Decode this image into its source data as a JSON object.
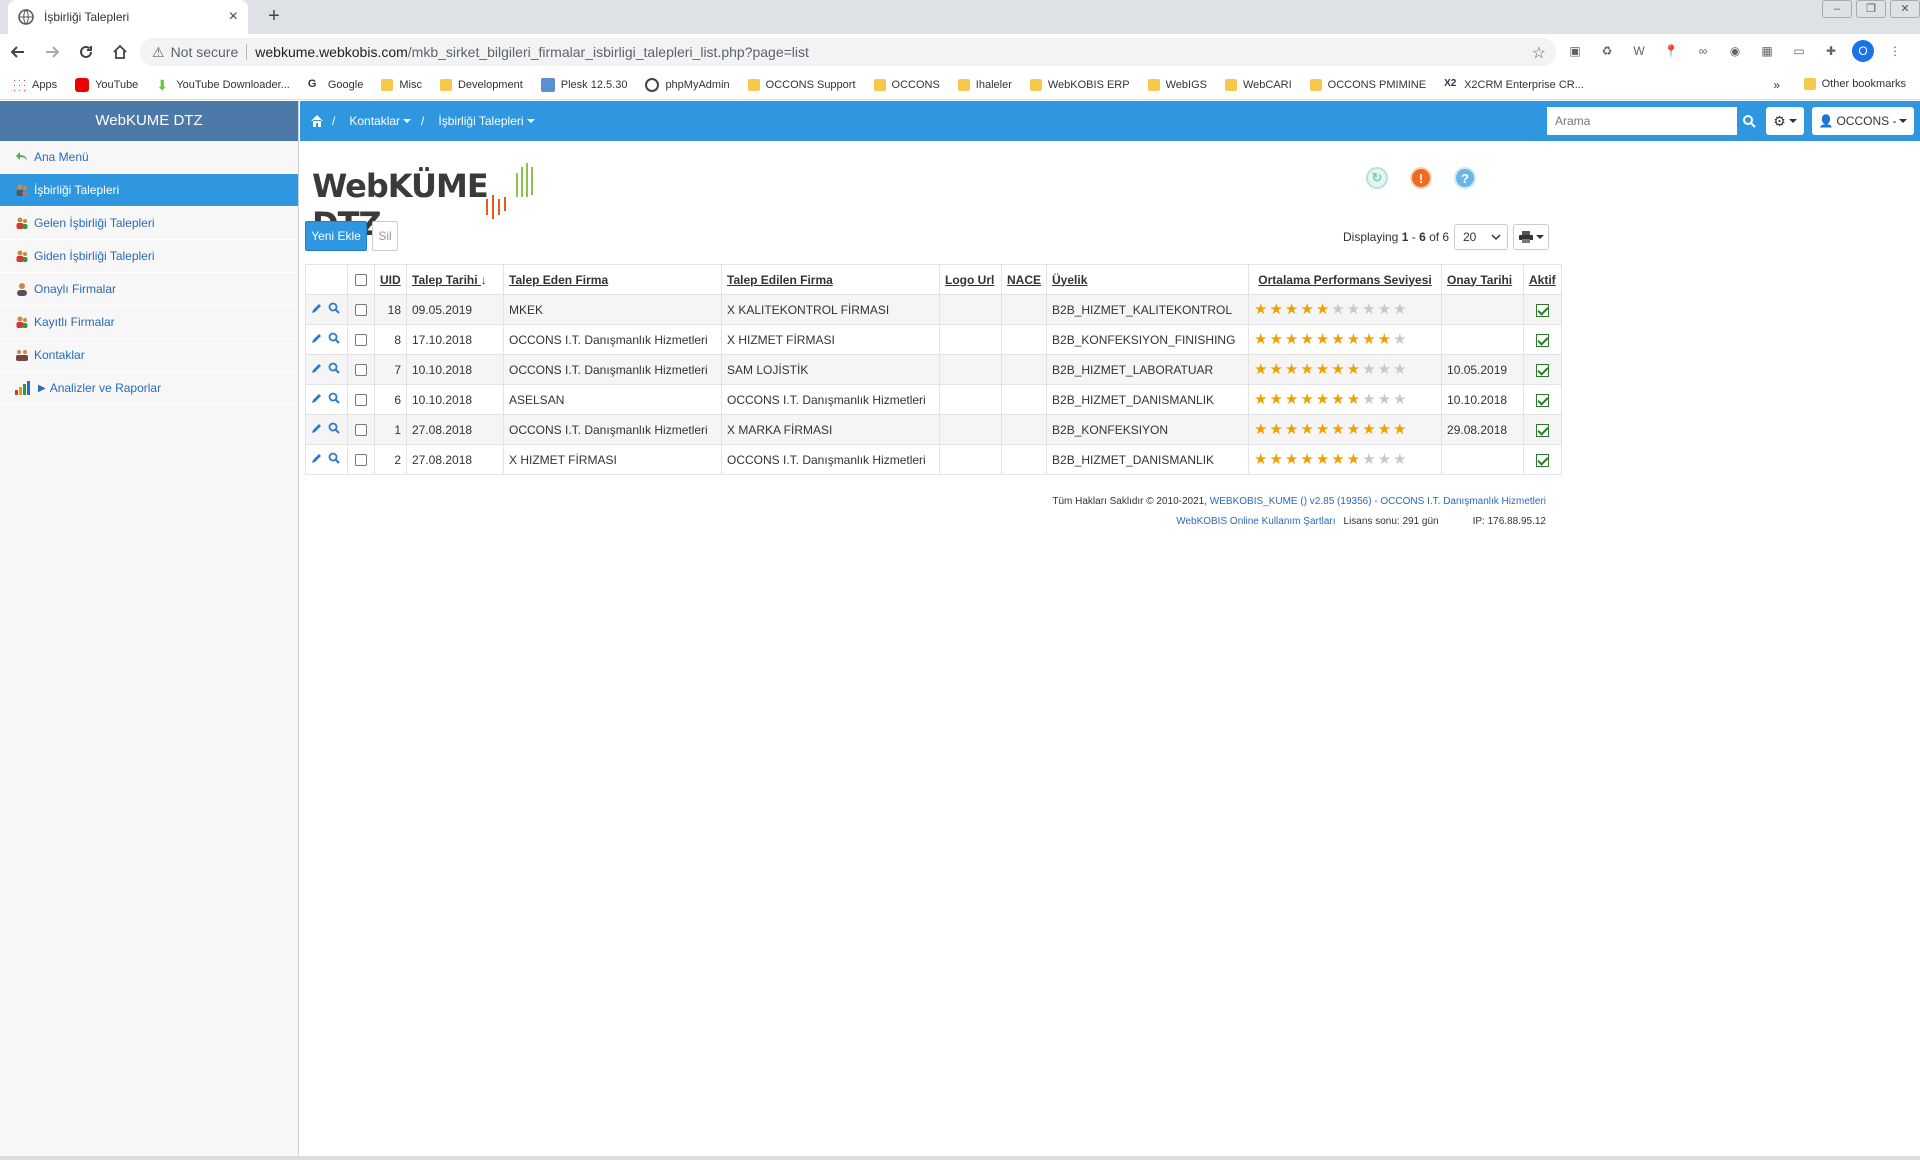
{
  "browser": {
    "tab_title": "İşbirliği Talepleri",
    "security_label": "Not secure",
    "url_host": "webkume.webkobis.com",
    "url_path": "/mkb_sirket_bilgileri_firmalar_isbirligi_talepleri_list.php?page=list",
    "bookmarks": [
      "Apps",
      "YouTube",
      "YouTube Downloader...",
      "Google",
      "Misc",
      "Development",
      "Plesk 12.5.30",
      "phpMyAdmin",
      "OCCONS Support",
      "OCCONS",
      "Ihaleler",
      "WebKOBIS ERP",
      "WebIGS",
      "WebCARI",
      "OCCONS PMIMINE",
      "X2CRM Enterprise CR..."
    ],
    "bookmarks_more": "»",
    "other_bookmarks": "Other bookmarks",
    "profile_initial": "O"
  },
  "sidebar": {
    "title": "WebKUME DTZ",
    "items": [
      {
        "label": "Ana Menü",
        "icon": "back-arrow-icon"
      },
      {
        "label": "İşbirliği Talepleri",
        "icon": "users-icon",
        "active": true
      },
      {
        "label": "Gelen İşbirliği Talepleri",
        "icon": "users-icon"
      },
      {
        "label": "Giden İşbirliği Talepleri",
        "icon": "users-icon"
      },
      {
        "label": "Onaylı Firmalar",
        "icon": "user-icon"
      },
      {
        "label": "Kayıtlı Firmalar",
        "icon": "users-icon"
      },
      {
        "label": "Kontaklar",
        "icon": "contacts-icon"
      },
      {
        "label": "Analizler ve Raporlar",
        "icon": "bar-chart-icon"
      }
    ]
  },
  "topnav": {
    "crumb1": "Kontaklar",
    "crumb2": "İşbirliği Talepleri",
    "search_placeholder": "Arama",
    "user_label": "OCCONS -"
  },
  "main": {
    "logo_text": "WebKÜME DTZ",
    "new_button": "Yeni Ekle",
    "delete_button": "Sil",
    "paging_prefix": "Displaying ",
    "paging_from": "1",
    "paging_dash": " - ",
    "paging_to": "6",
    "paging_of": " of 6",
    "page_size": "20"
  },
  "table": {
    "columns": [
      "UID",
      "Talep Tarihi",
      "Talep Eden Firma",
      "Talep Edilen Firma",
      "Logo Url",
      "NACE",
      "Üyelik",
      "Ortalama Performans Seviyesi",
      "Onay Tarihi",
      "Aktif"
    ],
    "rows": [
      {
        "uid": "18",
        "date": "09.05.2019",
        "from": "MKEK",
        "to": "X KALITEKONTROL FİRMASI",
        "logo": "",
        "nace": "",
        "membership": "B2B_HIZMET_KALITEKONTROL",
        "rating": 5,
        "approval": "",
        "active": true
      },
      {
        "uid": "8",
        "date": "17.10.2018",
        "from": "OCCONS I.T. Danışmanlık Hizmetleri",
        "to": "X HIZMET FİRMASI",
        "logo": "",
        "nace": "",
        "membership": "B2B_KONFEKSIYON_FINISHING",
        "rating": 9,
        "approval": "",
        "active": true
      },
      {
        "uid": "7",
        "date": "10.10.2018",
        "from": "OCCONS I.T. Danışmanlık Hizmetleri",
        "to": "SAM LOJİSTİK",
        "logo": "",
        "nace": "",
        "membership": "B2B_HIZMET_LABORATUAR",
        "rating": 7,
        "approval": "10.05.2019",
        "active": true
      },
      {
        "uid": "6",
        "date": "10.10.2018",
        "from": "ASELSAN",
        "to": "OCCONS I.T. Danışmanlık Hizmetleri",
        "logo": "",
        "nace": "",
        "membership": "B2B_HIZMET_DANISMANLIK",
        "rating": 7,
        "approval": "10.10.2018",
        "active": true
      },
      {
        "uid": "1",
        "date": "27.08.2018",
        "from": "OCCONS I.T. Danışmanlık Hizmetleri",
        "to": "X MARKA FİRMASI",
        "logo": "",
        "nace": "",
        "membership": "B2B_KONFEKSIYON",
        "rating": 10,
        "approval": "29.08.2018",
        "active": true
      },
      {
        "uid": "2",
        "date": "27.08.2018",
        "from": "X HIZMET FİRMASI",
        "to": "OCCONS I.T. Danışmanlık Hizmetleri",
        "logo": "",
        "nace": "",
        "membership": "B2B_HIZMET_DANISMANLIK",
        "rating": 7,
        "approval": "",
        "active": true
      }
    ],
    "rating_max": 10
  },
  "footer": {
    "copyright": "Tüm Hakları Saklıdır © 2010-2021, ",
    "version_link": "WEBKOBIS_KUME () v2.85 (19356) - OCCONS I.T. Danışmanlık Hizmetleri",
    "terms_link": "WebKOBIS Online Kullanım Şartları",
    "license": "Lisans sonu: 291 gün",
    "ip": "IP: 176.88.95.12"
  },
  "colors": {
    "primary": "#2f96e0",
    "sidebar_header": "#4d79a8",
    "star": "#f0a000",
    "link": "#2a6ab6"
  }
}
